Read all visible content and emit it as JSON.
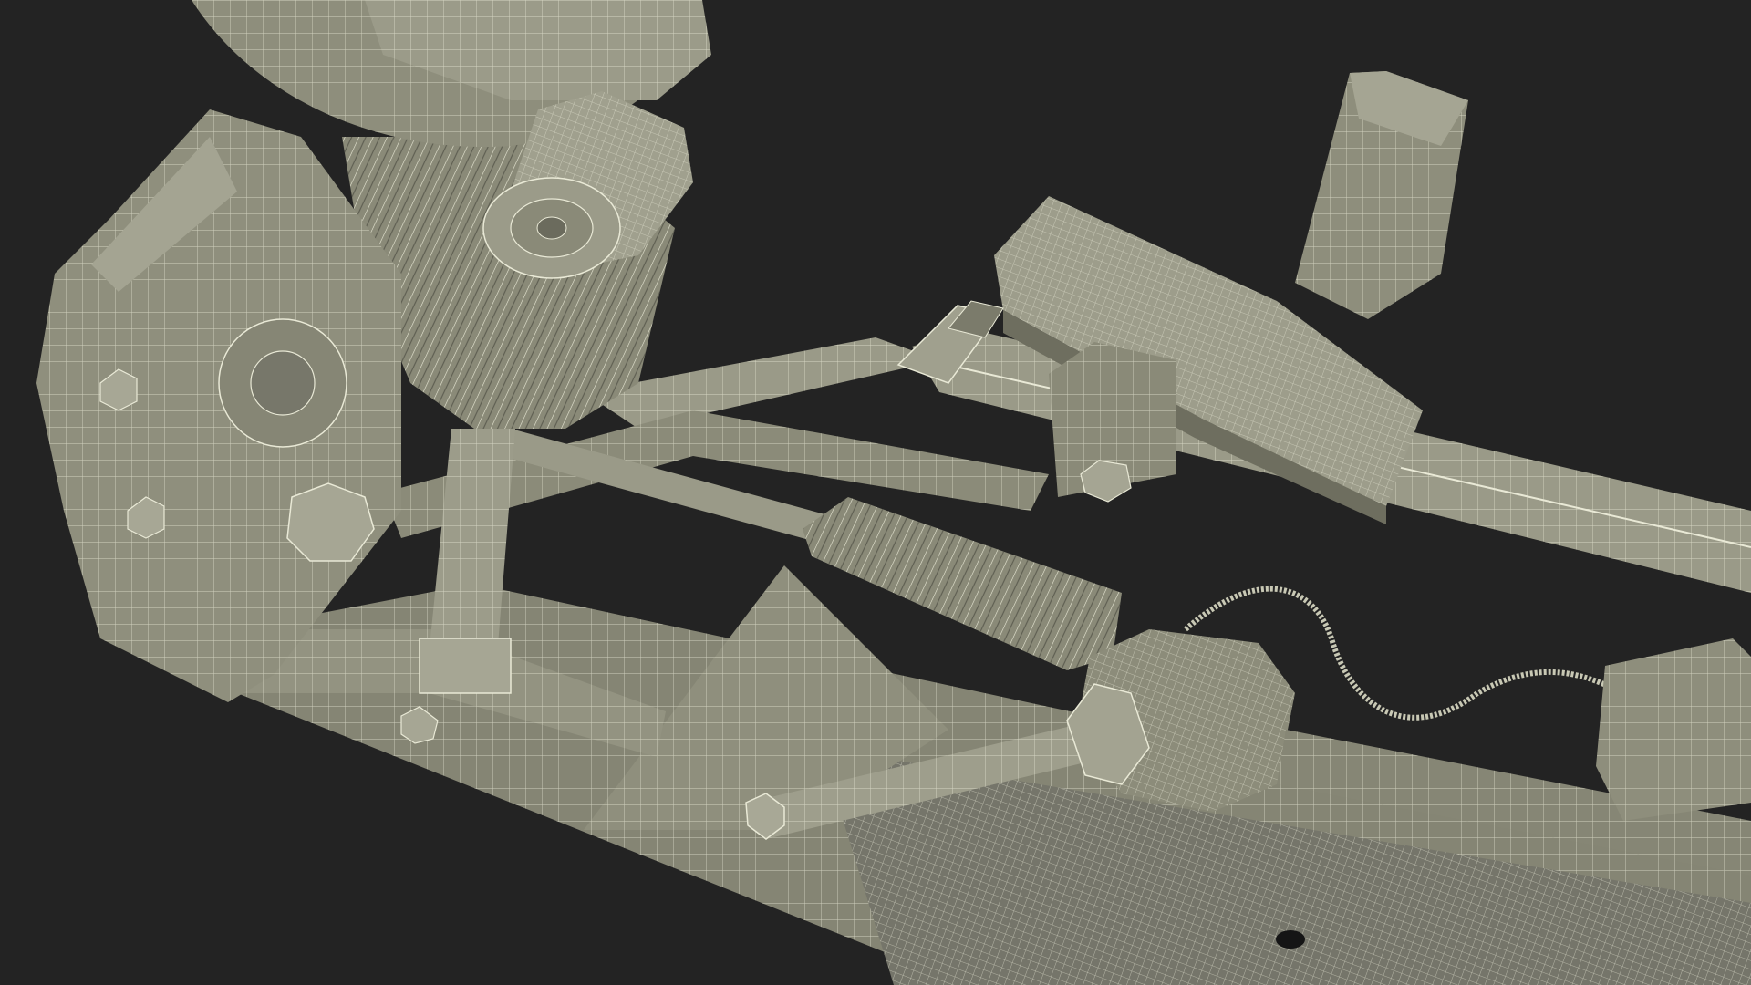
{
  "scene": {
    "subject": "wireframe-suspension-render",
    "colors": {
      "background": "#232323",
      "surface": "#8d8d7b",
      "surface_light": "#a3a391",
      "surface_dark": "#6e6e5f",
      "wire": "#e9e9d6"
    }
  }
}
